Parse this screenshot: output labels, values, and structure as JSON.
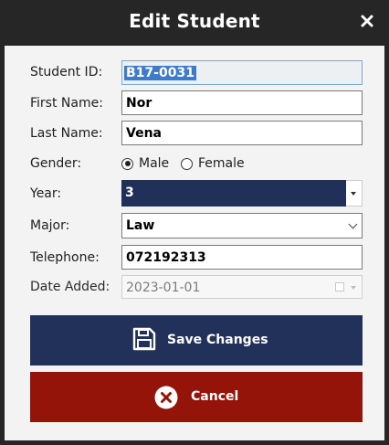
{
  "window": {
    "title": "Edit Student",
    "close_label": "Close"
  },
  "form": {
    "student_id": {
      "label": "Student ID:",
      "value": "B17-0031"
    },
    "first_name": {
      "label": "First Name:",
      "value": "Nor"
    },
    "last_name": {
      "label": "Last Name:",
      "value": "Vena"
    },
    "gender": {
      "label": "Gender:",
      "options": [
        "Male",
        "Female"
      ],
      "selected": "Male"
    },
    "year": {
      "label": "Year:",
      "value": "3"
    },
    "major": {
      "label": "Major:",
      "value": "Law"
    },
    "telephone": {
      "label": "Telephone:",
      "value": "072192313"
    },
    "date_added": {
      "label": "Date Added:",
      "value": "2023-01-01",
      "enabled": false
    }
  },
  "buttons": {
    "save": {
      "label": "Save Changes",
      "icon": "floppy-disk-icon",
      "color": "#22315a"
    },
    "cancel": {
      "label": "Cancel",
      "icon": "x-circle-icon",
      "color": "#941409"
    }
  },
  "colors": {
    "titlebar": "#262626",
    "panel": "#f3f3f3",
    "selection": "#3d7ccc",
    "year_field": "#213058"
  }
}
